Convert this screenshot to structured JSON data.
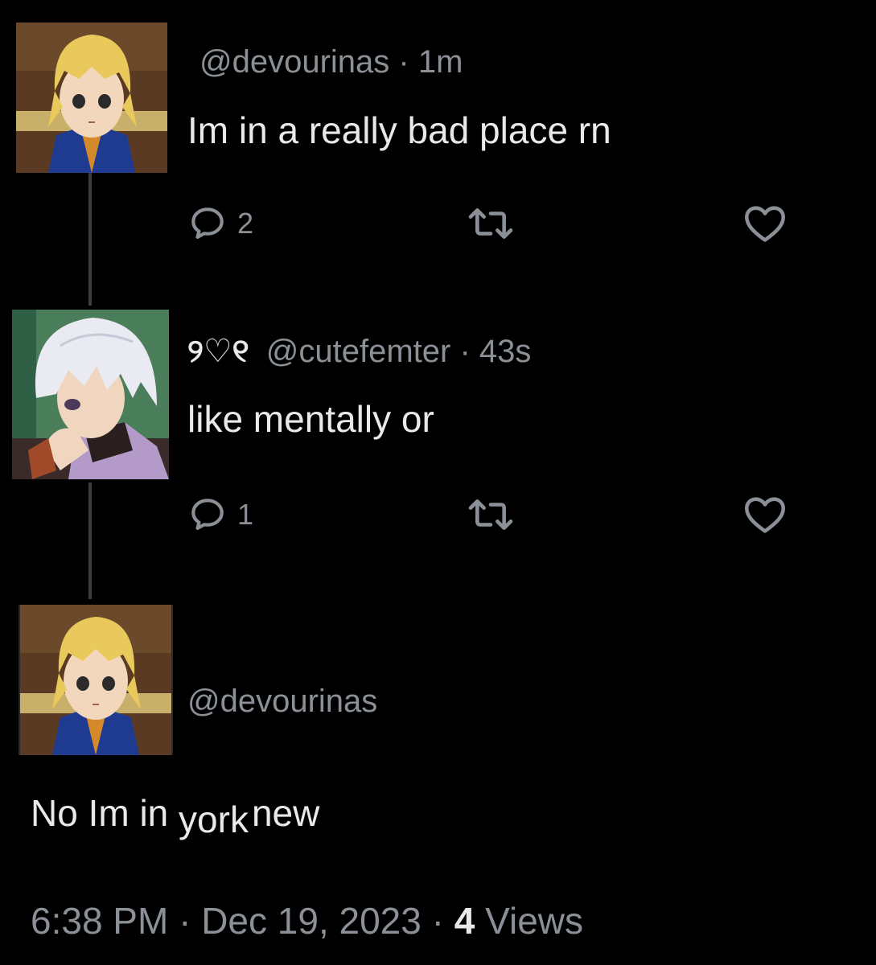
{
  "thread": {
    "tweet1": {
      "handle": "@devourinas",
      "time": "1m",
      "text": "Im in a really bad place rn",
      "replies": "2",
      "avatar_icon": "blonde-anime-character-avatar"
    },
    "tweet2": {
      "display_name": "୨♡୧",
      "handle": "@cutefemter",
      "time": "43s",
      "text": "like mentally or",
      "replies": "1",
      "avatar_icon": "white-haired-anime-character-avatar"
    },
    "tweet3": {
      "handle": "@devourinas",
      "text_part1": "No Im in",
      "text_part2": "york",
      "text_part3": "new",
      "avatar_icon": "blonde-anime-character-avatar"
    },
    "footer": {
      "time": "6:38 PM",
      "date": "Dec 19, 2023",
      "views_count": "4",
      "views_label": "Views"
    }
  },
  "separator": "·",
  "colors": {
    "background": "#000000",
    "text": "#e7e9ea",
    "muted": "#8b9096",
    "thread_line": "#3a3d40"
  }
}
